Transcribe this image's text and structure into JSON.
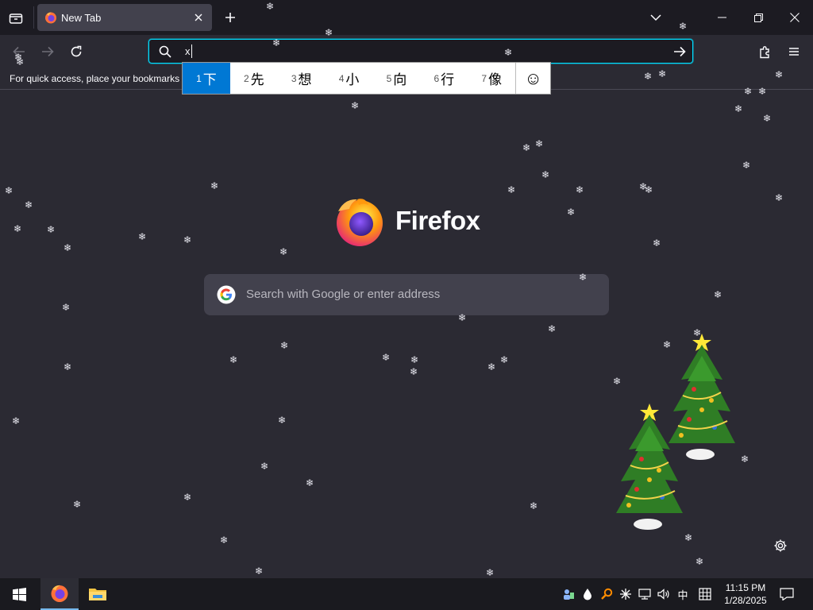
{
  "browser": {
    "tab": {
      "title": "New Tab"
    },
    "urlbar": {
      "value": "x"
    },
    "bookmarks_bar": {
      "message": "For quick access, place your bookmarks h"
    }
  },
  "ime": {
    "candidates": [
      {
        "num": "1",
        "char": "下"
      },
      {
        "num": "2",
        "char": "先"
      },
      {
        "num": "3",
        "char": "想"
      },
      {
        "num": "4",
        "char": "小"
      },
      {
        "num": "5",
        "char": "向"
      },
      {
        "num": "6",
        "char": "行"
      },
      {
        "num": "7",
        "char": "像"
      }
    ],
    "emoji": "☺"
  },
  "page": {
    "brand": "Firefox",
    "search": {
      "placeholder": "Search with Google or enter address"
    }
  },
  "taskbar": {
    "ime_mode": "中",
    "clock": {
      "time": "11:15 PM",
      "date": "1/28/2025"
    }
  },
  "colors": {
    "page_bg": "#2b2a33",
    "tabstrip_bg": "#1c1b22",
    "focus_ring": "#00ddff",
    "ime_selected": "#0078d4",
    "taskbar_bg": "#1a1a1f"
  },
  "icons": [
    "tab-list-icon",
    "firefox-icon",
    "close-icon",
    "plus-icon",
    "chevron-down-icon",
    "minimize-icon",
    "restore-icon",
    "back-icon",
    "forward-icon",
    "reload-icon",
    "search-icon",
    "arrow-right-icon",
    "extensions-icon",
    "menu-icon",
    "google-icon",
    "gear-icon",
    "windows-icon",
    "file-explorer-icon",
    "notification-icon"
  ]
}
